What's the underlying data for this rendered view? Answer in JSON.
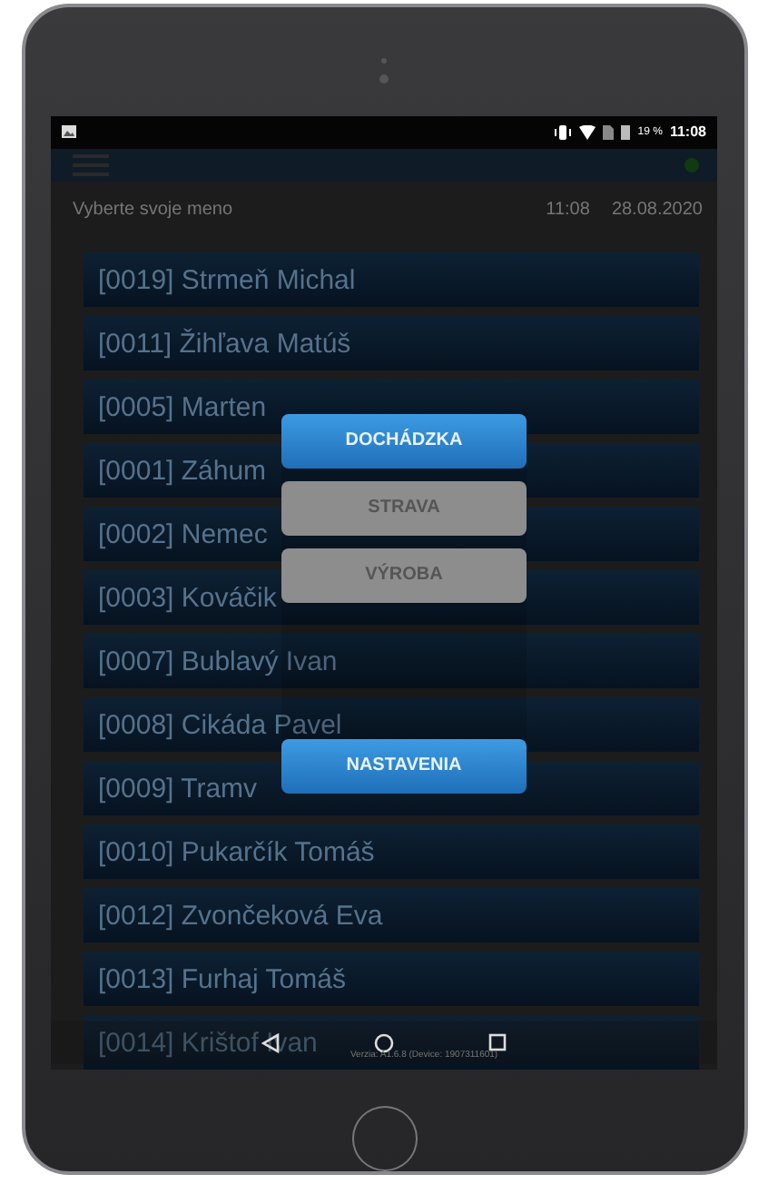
{
  "status_bar": {
    "battery": "19 %",
    "time": "11:08"
  },
  "header": {
    "title": "Vyberte svoje meno",
    "time": "11:08",
    "date": "28.08.2020"
  },
  "employees": [
    "[0019] Strmeň Michal",
    "[0011] Žihľava Matúš",
    "[0005] Marten",
    "[0001] Záhum",
    "[0002] Nemec",
    "[0003] Kováčik",
    "[0007] Bublavý Ivan",
    "[0008] Cikáda Pavel",
    "[0009] Tramv",
    "[0010] Pukarčík Tomáš",
    "[0012] Zvončeková Eva",
    "[0013] Furhaj Tomáš",
    "[0014] Krištof Ivan"
  ],
  "menu": [
    {
      "label": "DOCHÁDZKA",
      "disabled": false
    },
    {
      "label": "STRAVA",
      "disabled": true
    },
    {
      "label": "VÝROBA",
      "disabled": true
    },
    {
      "label": "NASTAVENIA",
      "disabled": false
    }
  ],
  "version": "Verzia: A1.6.8 (Device: 1907311601)"
}
